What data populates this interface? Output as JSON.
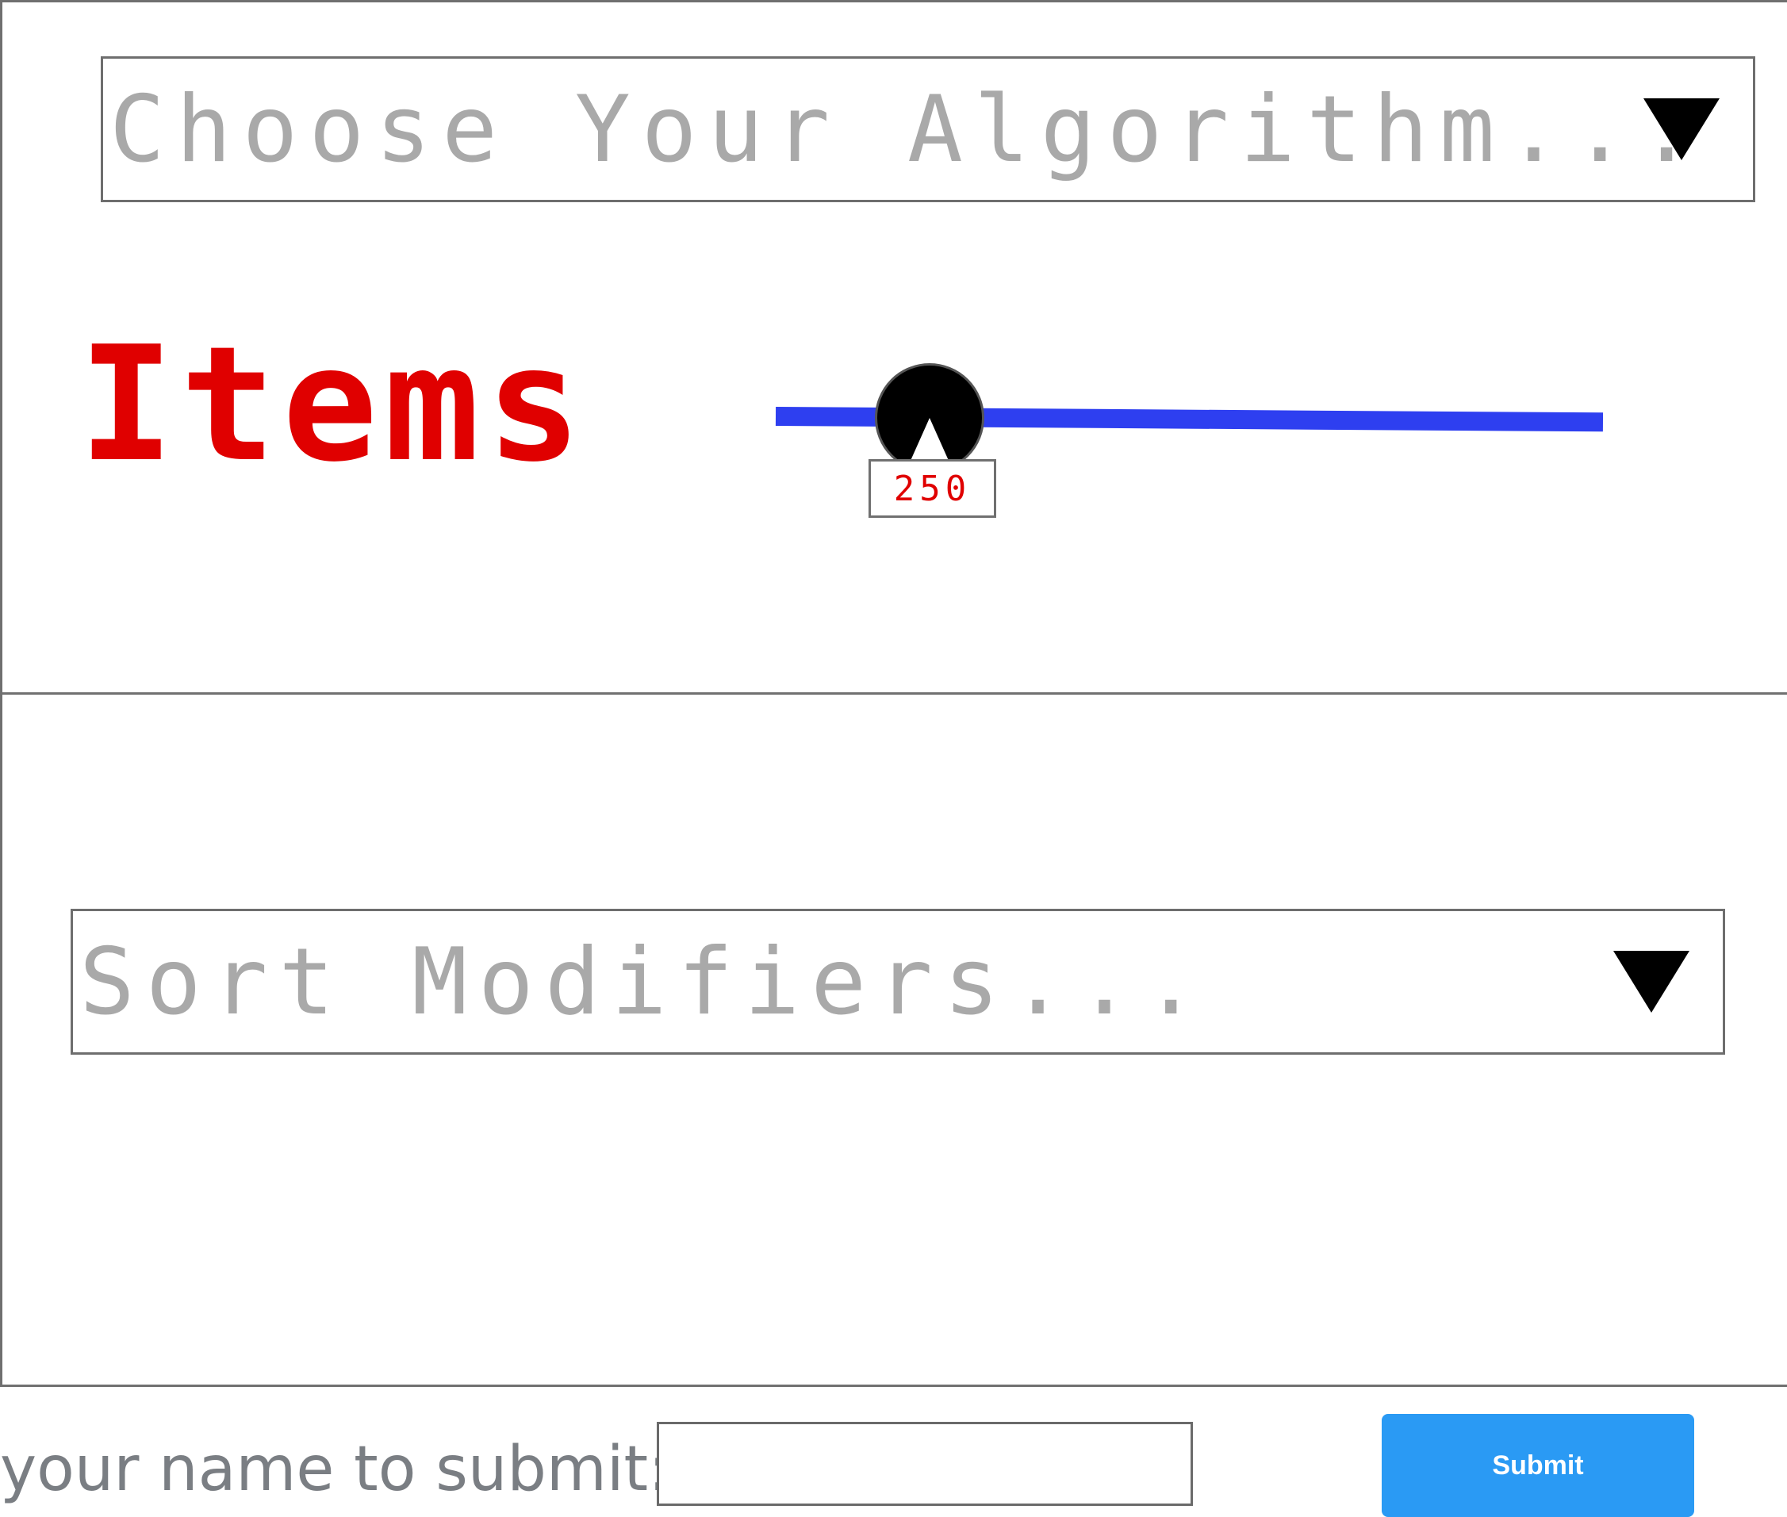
{
  "algorithm_dropdown": {
    "placeholder": "Choose Your Algorithm...",
    "arrow_icon": "triangle-down-icon"
  },
  "items": {
    "label": "Items",
    "slider_value": "250",
    "slider_color": "#2e3ff0",
    "label_color": "#e00000"
  },
  "sort_modifiers_dropdown": {
    "placeholder": "Sort Modifiers...",
    "arrow_icon": "triangle-down-icon"
  },
  "submit_form": {
    "label": "your name to submit:",
    "input_value": "",
    "button_label": "Submit",
    "button_color": "#2a9af4"
  }
}
